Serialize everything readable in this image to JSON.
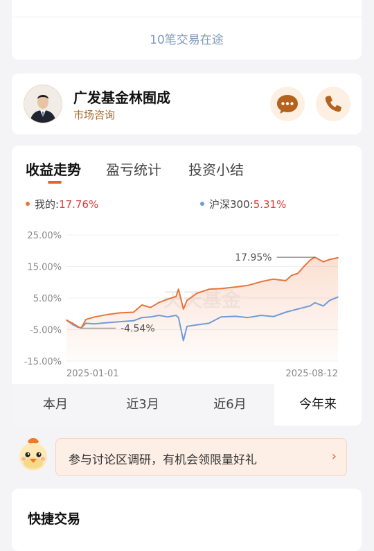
{
  "top_card": {
    "pending_text": "10笔交易在途"
  },
  "advisor": {
    "name": "广发基金林囿成",
    "role": "市场咨询"
  },
  "tabs": [
    "收益走势",
    "盈亏统计",
    "投资小结"
  ],
  "legend": {
    "mine_label": "我的:",
    "mine_value": "17.76%",
    "index_label": "沪深300:",
    "index_value": "5.31%"
  },
  "colors": {
    "mine": "#e8733d",
    "index": "#6f9bd8",
    "accent": "#e8622d",
    "value_red": "#e03a3a"
  },
  "watermark": "天天基金",
  "chart_data": {
    "type": "line",
    "ylim": [
      -15,
      25
    ],
    "y_ticks": [
      "25.00%",
      "15.00%",
      "5.00%",
      "-5.00%",
      "-15.00%"
    ],
    "y_tick_values": [
      25,
      15,
      5,
      -5,
      -15
    ],
    "x_labels": [
      "2025-01-01",
      "2025-08-12"
    ],
    "x_range": [
      "2025-01-01",
      "2025-08-12"
    ],
    "annotations": [
      {
        "text": "17.95%",
        "date": "2025-07-24",
        "value": 17.95
      },
      {
        "text": "-4.54%",
        "date": "2025-01-13",
        "value": -4.54
      }
    ],
    "series": [
      {
        "name": "我的",
        "points": [
          [
            "2025-01-01",
            -2.0
          ],
          [
            "2025-01-06",
            -3.0
          ],
          [
            "2025-01-10",
            -4.0
          ],
          [
            "2025-01-13",
            -4.54
          ],
          [
            "2025-01-17",
            -1.8
          ],
          [
            "2025-01-24",
            -1.0
          ],
          [
            "2025-02-04",
            -0.2
          ],
          [
            "2025-02-14",
            0.3
          ],
          [
            "2025-02-25",
            0.5
          ],
          [
            "2025-03-04",
            2.8
          ],
          [
            "2025-03-11",
            2.0
          ],
          [
            "2025-03-18",
            3.6
          ],
          [
            "2025-03-25",
            4.6
          ],
          [
            "2025-04-01",
            5.5
          ],
          [
            "2025-04-03",
            7.8
          ],
          [
            "2025-04-07",
            1.5
          ],
          [
            "2025-04-10",
            4.2
          ],
          [
            "2025-04-18",
            6.5
          ],
          [
            "2025-04-28",
            7.8
          ],
          [
            "2025-05-08",
            8.0
          ],
          [
            "2025-05-20",
            8.5
          ],
          [
            "2025-05-30",
            9.0
          ],
          [
            "2025-06-10",
            10.2
          ],
          [
            "2025-06-20",
            11.0
          ],
          [
            "2025-06-30",
            10.5
          ],
          [
            "2025-07-05",
            12.2
          ],
          [
            "2025-07-10",
            12.8
          ],
          [
            "2025-07-15",
            15.0
          ],
          [
            "2025-07-20",
            17.0
          ],
          [
            "2025-07-24",
            17.95
          ],
          [
            "2025-07-31",
            16.5
          ],
          [
            "2025-08-05",
            17.2
          ],
          [
            "2025-08-12",
            17.76
          ]
        ]
      },
      {
        "name": "沪深300",
        "points": [
          [
            "2025-01-01",
            -2.0
          ],
          [
            "2025-01-06",
            -3.4
          ],
          [
            "2025-01-10",
            -4.2
          ],
          [
            "2025-01-13",
            -4.5
          ],
          [
            "2025-01-17",
            -3.0
          ],
          [
            "2025-01-24",
            -3.2
          ],
          [
            "2025-02-04",
            -2.8
          ],
          [
            "2025-02-14",
            -2.5
          ],
          [
            "2025-02-25",
            -2.2
          ],
          [
            "2025-03-04",
            -1.2
          ],
          [
            "2025-03-11",
            -1.0
          ],
          [
            "2025-03-18",
            -0.5
          ],
          [
            "2025-03-25",
            -1.0
          ],
          [
            "2025-04-01",
            -0.5
          ],
          [
            "2025-04-03",
            -1.2
          ],
          [
            "2025-04-07",
            -8.5
          ],
          [
            "2025-04-10",
            -4.0
          ],
          [
            "2025-04-18",
            -3.5
          ],
          [
            "2025-04-28",
            -3.0
          ],
          [
            "2025-05-08",
            -1.0
          ],
          [
            "2025-05-20",
            -0.8
          ],
          [
            "2025-05-30",
            -1.2
          ],
          [
            "2025-06-10",
            -0.5
          ],
          [
            "2025-06-20",
            -0.9
          ],
          [
            "2025-06-30",
            0.5
          ],
          [
            "2025-07-05",
            1.0
          ],
          [
            "2025-07-10",
            1.5
          ],
          [
            "2025-07-15",
            2.0
          ],
          [
            "2025-07-20",
            2.5
          ],
          [
            "2025-07-24",
            3.5
          ],
          [
            "2025-07-31",
            2.5
          ],
          [
            "2025-08-05",
            4.2
          ],
          [
            "2025-08-12",
            5.31
          ]
        ]
      }
    ]
  },
  "ranges": [
    "本月",
    "近3月",
    "近6月",
    "今年来"
  ],
  "selected_range": "今年来",
  "promo": {
    "text": "参与讨论区调研，有机会领限量好礼",
    "chevron": "›"
  },
  "quick_trade": {
    "title": "快捷交易"
  },
  "icons": {
    "chat": "chat-bubble-icon",
    "phone": "phone-icon",
    "avatar": "advisor-photo",
    "mascot": "chick-mascot-icon"
  }
}
